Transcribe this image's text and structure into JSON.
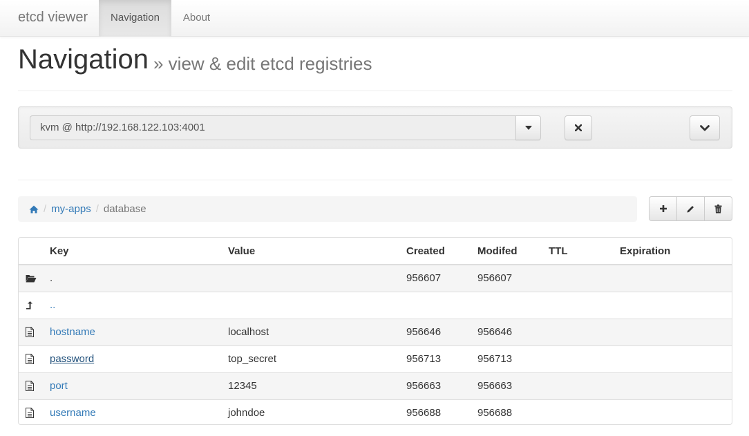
{
  "navbar": {
    "brand": "etcd viewer",
    "tabs": [
      {
        "label": "Navigation",
        "active": true
      },
      {
        "label": "About",
        "active": false
      }
    ]
  },
  "header": {
    "title": "Navigation",
    "subtitle": "» view & edit etcd registries"
  },
  "server": {
    "selected": "kvm @ http://192.168.122.103:4001",
    "caret_icon": "caret-down-icon",
    "close_icon": "close-icon",
    "expand_icon": "chevron-down-icon"
  },
  "breadcrumb": {
    "home_icon": "home-icon",
    "items": [
      "my-apps",
      "database"
    ]
  },
  "toolbar": {
    "add_icon": "plus-icon",
    "edit_icon": "pencil-icon",
    "delete_icon": "trash-icon"
  },
  "table": {
    "headers": [
      "Key",
      "Value",
      "Created",
      "Modifed",
      "TTL",
      "Expiration"
    ],
    "rows": [
      {
        "icon": "folder-open-icon",
        "key": ".",
        "value": "",
        "created": "956607",
        "modified": "956607",
        "ttl": "",
        "expiration": "",
        "link": false
      },
      {
        "icon": "level-up-icon",
        "key": "..",
        "value": "",
        "created": "",
        "modified": "",
        "ttl": "",
        "expiration": "",
        "link": true
      },
      {
        "icon": "file-icon",
        "key": "hostname",
        "value": "localhost",
        "created": "956646",
        "modified": "956646",
        "ttl": "",
        "expiration": "",
        "link": true
      },
      {
        "icon": "file-icon",
        "key": "password",
        "value": "top_secret",
        "created": "956713",
        "modified": "956713",
        "ttl": "",
        "expiration": "",
        "link": true,
        "hover": true
      },
      {
        "icon": "file-icon",
        "key": "port",
        "value": "12345",
        "created": "956663",
        "modified": "956663",
        "ttl": "",
        "expiration": "",
        "link": true
      },
      {
        "icon": "file-icon",
        "key": "username",
        "value": "johndoe",
        "created": "956688",
        "modified": "956688",
        "ttl": "",
        "expiration": "",
        "link": true
      }
    ]
  },
  "colors": {
    "link": "#337ab7",
    "link_hover": "#23527c",
    "text": "#333333",
    "muted": "#777777"
  }
}
